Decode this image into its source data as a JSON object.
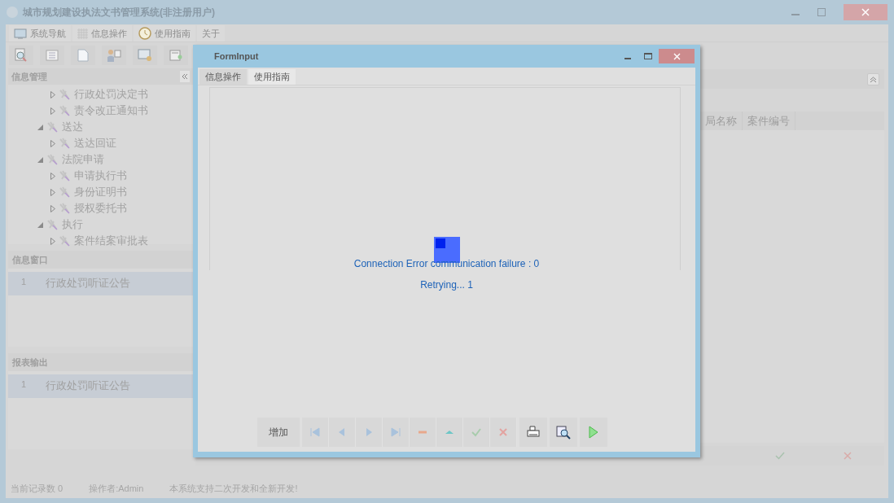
{
  "window": {
    "title": "城市规划建设执法文书管理系统(非注册用户)"
  },
  "menu": [
    {
      "label": "系统导航",
      "kind": "monitor"
    },
    {
      "label": "信息操作",
      "kind": "grid"
    },
    {
      "label": "使用指南",
      "kind": "clock"
    },
    {
      "label": "关于",
      "kind": "plain"
    }
  ],
  "sidebar": {
    "title": "信息管理",
    "scrolled_children": [
      {
        "label": "行政处罚决定书",
        "expanded": false
      },
      {
        "label": "责令改正通知书",
        "expanded": false
      }
    ],
    "tree": [
      {
        "label": "送达",
        "expanded": true,
        "children": [
          {
            "label": "送达回证",
            "expanded": false
          }
        ]
      },
      {
        "label": "法院申请",
        "expanded": true,
        "children": [
          {
            "label": "申请执行书",
            "expanded": false
          },
          {
            "label": "身份证明书",
            "expanded": false
          },
          {
            "label": "授权委托书",
            "expanded": false
          }
        ]
      },
      {
        "label": "执行",
        "expanded": true,
        "children": [
          {
            "label": "案件结案审批表",
            "expanded": false
          }
        ]
      }
    ]
  },
  "info_window": {
    "title": "信息窗口",
    "rows": [
      {
        "index": "1",
        "label": "行政处罚听证公告"
      }
    ]
  },
  "report_output": {
    "title": "报表输出",
    "rows": [
      {
        "index": "1",
        "label": "行政处罚听证公告"
      }
    ]
  },
  "table": {
    "columns": [
      "局名称",
      "案件编号"
    ]
  },
  "status_bar": [
    "当前记录数 0",
    "操作者:Admin",
    "本系统支持二次开发和全新开发!"
  ],
  "dialog": {
    "title": "FormInput",
    "tabs": [
      {
        "label": "信息操作",
        "selected": true
      },
      {
        "label": "使用指南",
        "selected": false
      }
    ],
    "messages": [
      "Connection Error communication failure : 0",
      "Retrying... 1"
    ],
    "add_button": "增加"
  }
}
